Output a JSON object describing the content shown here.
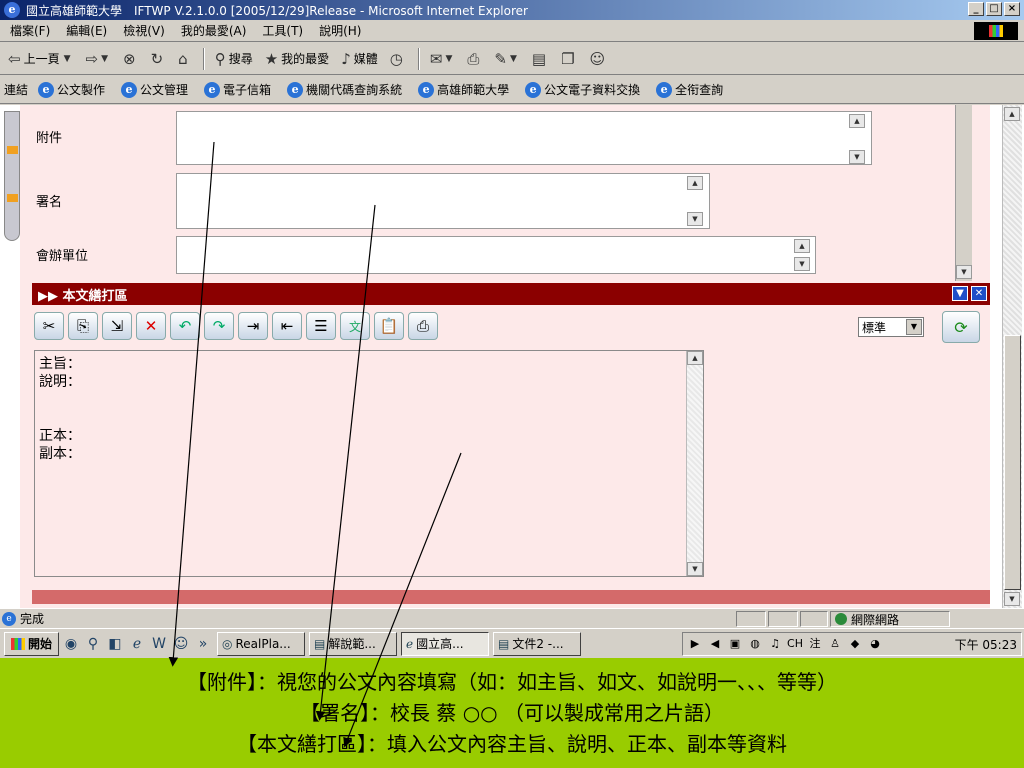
{
  "window": {
    "title": "國立高雄師範大學　IFTWP V.2.1.0.0 [2005/12/29]Release - Microsoft Internet Explorer",
    "min": "_",
    "max": "□",
    "close": "×"
  },
  "menu": [
    "檔案(F)",
    "編輯(E)",
    "檢視(V)",
    "我的最愛(A)",
    "工具(T)",
    "說明(H)"
  ],
  "toolbar": {
    "back": "上一頁",
    "search": "搜尋",
    "favorites": "我的最愛",
    "media": "媒體"
  },
  "links": {
    "label": "連結",
    "items": [
      "公文製作",
      "公文管理",
      "電子信箱",
      "機關代碼查詢系統",
      "高雄師範大學",
      "公文電子資料交換",
      "全衔查詢"
    ]
  },
  "form": {
    "attachment_label": "附件",
    "signature_label": "署名",
    "co_unit_label": "會辦單位"
  },
  "section": {
    "title": "▶▶ 本文繕打區"
  },
  "editor": {
    "style_value": "標準",
    "lines": [
      "主旨：",
      "說明：",
      "",
      "",
      "正本：",
      "副本："
    ]
  },
  "status": {
    "text": "完成",
    "zone": "網際網路"
  },
  "taskbar": {
    "start": "開始",
    "tasks": [
      "RealPla...",
      "解說範...",
      "國立高...",
      "文件2 -..."
    ],
    "clock": "下午 05:23"
  },
  "caption": {
    "line1": "【附件】：視您的公文內容填寫（如：如主旨、如文、如說明一、、、等等）",
    "line2": "【署名】：校長 蔡 ○○ （可以製成常用之片語）",
    "line3": "【本文繕打區】：填入公文內容主旨、說明、正本、副本等資料"
  },
  "colors": {
    "section_header": "#8b0000",
    "page_bg": "#fde9e9",
    "caption_bg": "#99cc00"
  }
}
